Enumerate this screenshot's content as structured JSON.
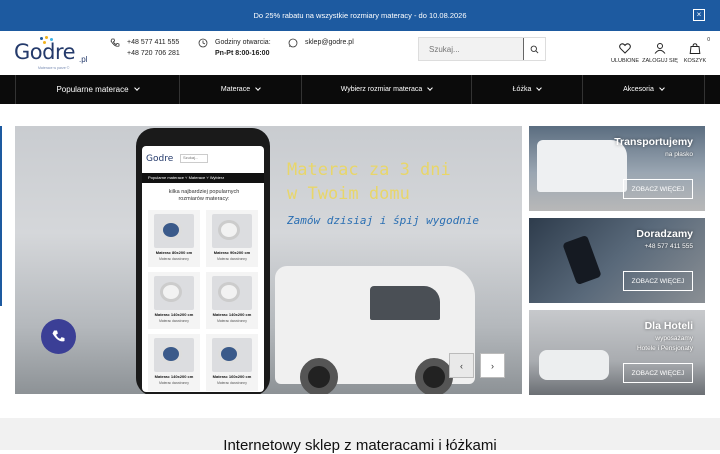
{
  "promo": {
    "text": "Do 25% rabatu na wszystkie rozmiary materacy - do 10.08.2026",
    "close": "×"
  },
  "logo": {
    "name": "Godre",
    "tld": ".pl",
    "tagline": "Materace w parze ©",
    "colors": [
      "#1d5aa0",
      "#f2b21c",
      "#3bb3e5",
      "#1d5aa0",
      "#f2b21c"
    ]
  },
  "contact": {
    "phone1": "+48 577 411 555",
    "phone2": "+48 720 706 281",
    "hours_label": "Godziny otwarcia:",
    "hours_value": "Pn-Pt 8:00-16:00",
    "email": "sklep@godre.pl"
  },
  "search": {
    "placeholder": "Szukaj..."
  },
  "header_icons": {
    "wishlist": "ULUBIONE",
    "login": "ZALOGUJ SIĘ",
    "cart": "KOSZYK",
    "cart_count": "0"
  },
  "nav": {
    "items": [
      {
        "label": "Popularne materace"
      },
      {
        "label": "Materace"
      },
      {
        "label": "Wybierz rozmiar materaca"
      },
      {
        "label": "Łóżka"
      },
      {
        "label": "Akcesoria"
      }
    ]
  },
  "hero": {
    "line1": "Materac za 3 dni",
    "line2": "w Twoim domu",
    "line3": "Zamów dzisiaj i śpij wygodnie",
    "phone_screen": {
      "logo": "Godre",
      "search": "Szukaj...",
      "nav": "Popularne materace ˅   Materace ˅   Wybierz",
      "heading": "kilka najbardziej popularnych rozmiarów materacy:",
      "tiles": [
        {
          "title": "Materac 80x200 cm",
          "sub": "Materac dwustronny"
        },
        {
          "title": "Materac 90x200 cm",
          "sub": "Materac dwustronny"
        },
        {
          "title": "Materac 140x200 cm",
          "sub": "Materac dwustronny"
        },
        {
          "title": "Materac 140x200 cm",
          "sub": "Materac dwustronny"
        },
        {
          "title": "Materac 140x200 cm",
          "sub": "Materac dwustronny"
        },
        {
          "title": "Materac 160x200 cm",
          "sub": "Materac dwustronny"
        }
      ]
    },
    "prev": "‹",
    "next": "›"
  },
  "cards": [
    {
      "title": "Transportujemy",
      "sub": [
        "na płasko"
      ],
      "button": "ZOBACZ WIĘCEJ"
    },
    {
      "title": "Doradzamy",
      "sub": [
        "+48 577 411 555"
      ],
      "button": "ZOBACZ WIĘCEJ"
    },
    {
      "title": "Dla Hoteli",
      "sub": [
        "wyposażamy",
        "Hotele i Pensjonaty"
      ],
      "button": "ZOBACZ WIĘCEJ"
    }
  ],
  "section": {
    "title": "Internetowy sklep z materacami i łóżkami"
  }
}
